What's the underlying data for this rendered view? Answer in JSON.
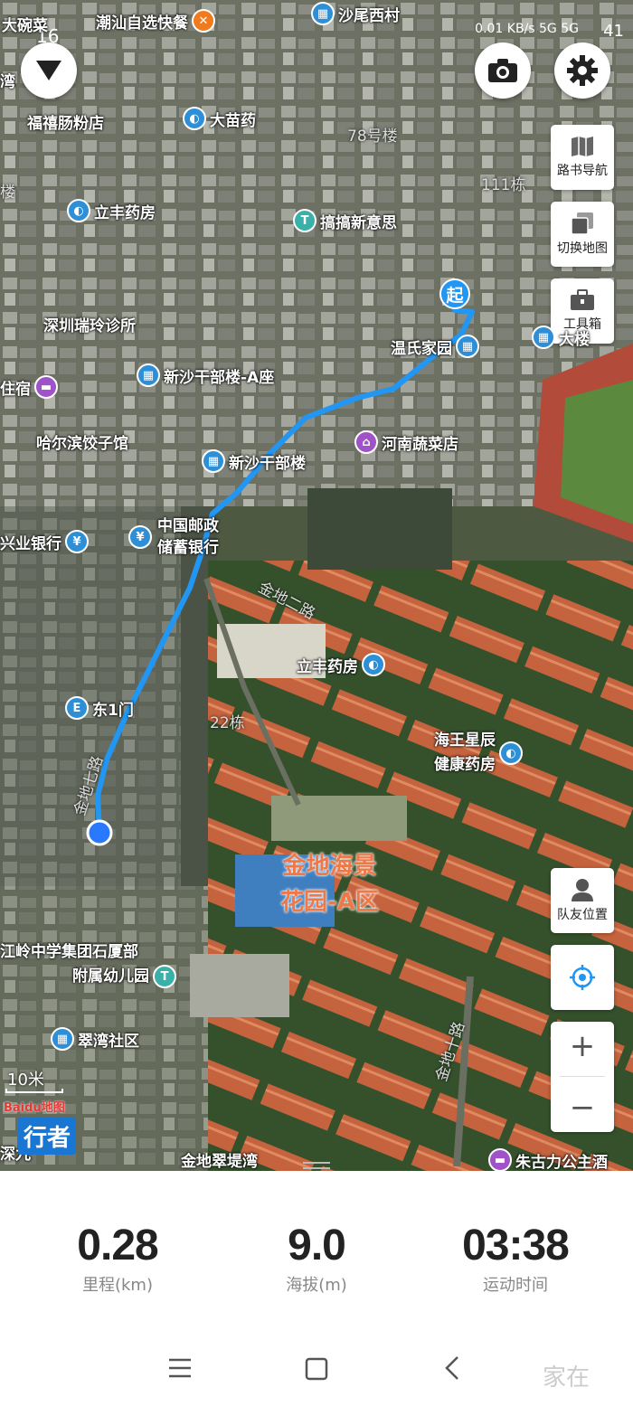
{
  "status_bar": {
    "time": "16",
    "network": "0.01 KB/s  5G  5G",
    "battery": "41"
  },
  "controls": {
    "route_book_label": "路书导航",
    "switch_map_label": "切换地图",
    "toolbox_label": "工具箱",
    "teammate_label": "队友位置",
    "zoom_in": "+",
    "zoom_out": "−"
  },
  "map": {
    "start_marker": "起",
    "scale_label": "10米",
    "brand_logo": "Baidu地图",
    "brand_label": "行者",
    "area_label_line1": "金地海景",
    "area_label_line2": "花园-A区",
    "pois": [
      {
        "id": "p1",
        "name": "大碗菜"
      },
      {
        "id": "p2",
        "name": "潮汕自选快餐"
      },
      {
        "id": "p3",
        "name": "沙尾西村"
      },
      {
        "id": "p4",
        "name": "湾"
      },
      {
        "id": "p5",
        "name": "福禧肠粉店"
      },
      {
        "id": "p6",
        "name": "大苗药"
      },
      {
        "id": "p7",
        "name": "78号楼"
      },
      {
        "id": "p8",
        "name": "111栋"
      },
      {
        "id": "p9",
        "name": "楼"
      },
      {
        "id": "p10",
        "name": "立丰药房"
      },
      {
        "id": "p11",
        "name": "搞搞新意思"
      },
      {
        "id": "p12",
        "name": "深圳瑞玲诊所"
      },
      {
        "id": "p13",
        "name": "温氏家园"
      },
      {
        "id": "p14",
        "name": "大楼"
      },
      {
        "id": "p15",
        "name": "住宿"
      },
      {
        "id": "p16",
        "name": "新沙干部楼-A座"
      },
      {
        "id": "p17",
        "name": "哈尔滨饺子馆"
      },
      {
        "id": "p18",
        "name": "河南蔬菜店"
      },
      {
        "id": "p19",
        "name": "新沙干部楼"
      },
      {
        "id": "p20",
        "name": "兴业银行"
      },
      {
        "id": "p21",
        "name": "中国邮政"
      },
      {
        "id": "p22",
        "name": "储蓄银行"
      },
      {
        "id": "p23",
        "name": "金地二路"
      },
      {
        "id": "p24",
        "name": "立丰药房"
      },
      {
        "id": "p25",
        "name": "东1门"
      },
      {
        "id": "p26",
        "name": "22栋"
      },
      {
        "id": "p27",
        "name": "海王星辰"
      },
      {
        "id": "p28",
        "name": "健康药房"
      },
      {
        "id": "p29",
        "name": "金地七路"
      },
      {
        "id": "p30",
        "name": "江岭中学集团石厦部"
      },
      {
        "id": "p31",
        "name": "附属幼儿园"
      },
      {
        "id": "p32",
        "name": "金地十路"
      },
      {
        "id": "p33",
        "name": "翠湾社区"
      },
      {
        "id": "p34",
        "name": "深九"
      },
      {
        "id": "p35",
        "name": "金地翠堤湾"
      },
      {
        "id": "p36",
        "name": "朱古力公主酒"
      }
    ]
  },
  "stats": [
    {
      "value": "0.28",
      "label": "里程(km)"
    },
    {
      "value": "9.0",
      "label": "海拔(m)"
    },
    {
      "value": "03:38",
      "label": "运动时间"
    }
  ],
  "watermark": "家在"
}
